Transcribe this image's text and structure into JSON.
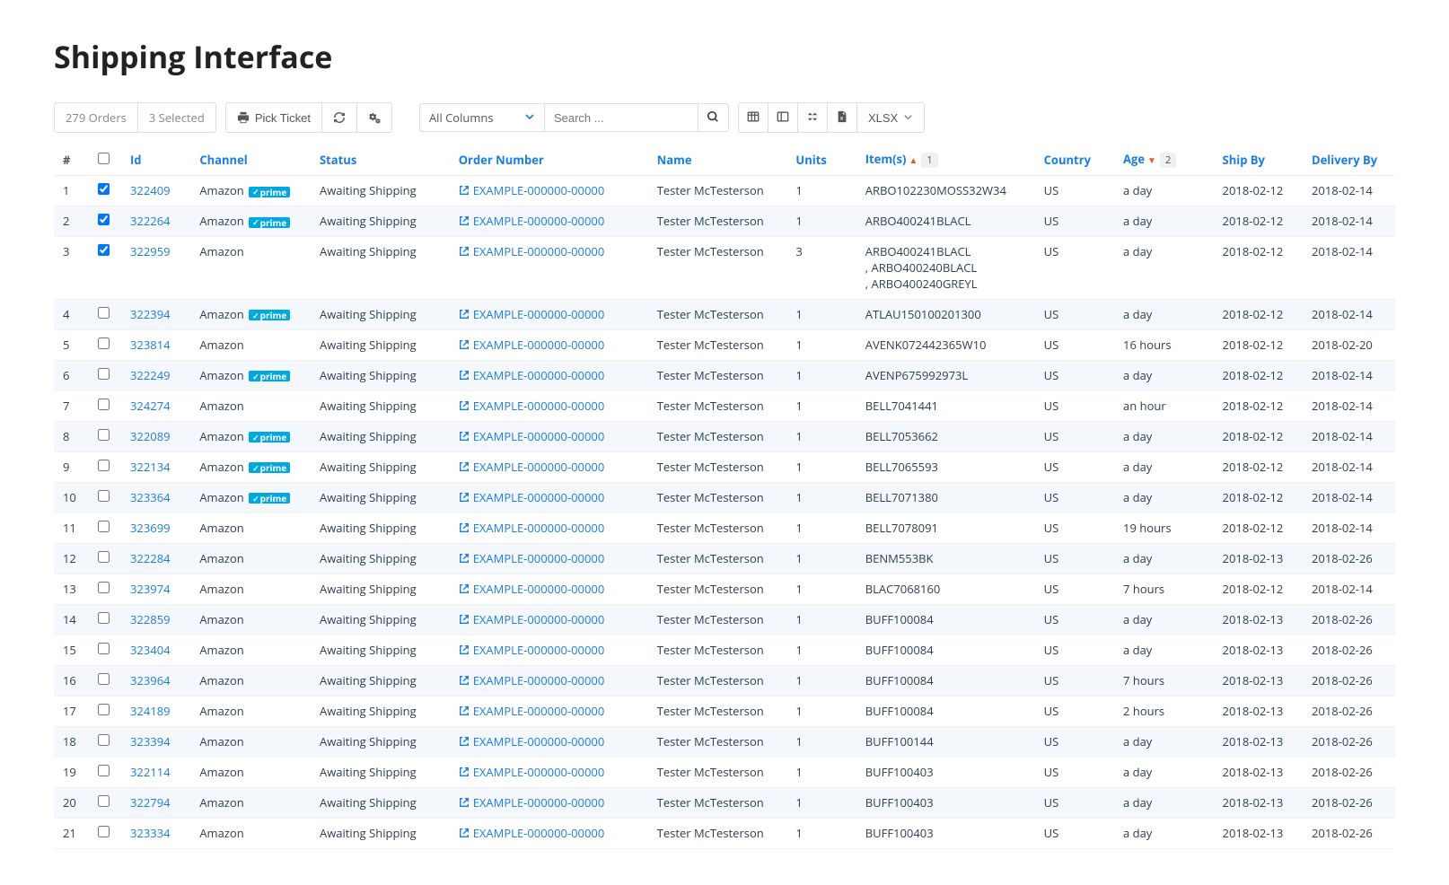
{
  "title": "Shipping Interface",
  "toolbar": {
    "order_count": "279 Orders",
    "selected_count": "3 Selected",
    "pick_ticket_label": "Pick Ticket",
    "columns_filter": "All Columns",
    "search_placeholder": "Search ...",
    "export_format": "XLSX"
  },
  "columns": {
    "row_num": "#",
    "id": "Id",
    "channel": "Channel",
    "status": "Status",
    "order_number": "Order Number",
    "name": "Name",
    "units": "Units",
    "items": "Item(s)",
    "items_badge": "1",
    "country": "Country",
    "age": "Age",
    "age_badge": "2",
    "ship_by": "Ship By",
    "delivery_by": "Delivery By"
  },
  "rows": [
    {
      "n": "1",
      "checked": true,
      "id": "322409",
      "channel": "Amazon",
      "prime": true,
      "status": "Awaiting Shipping",
      "order": "EXAMPLE-000000-00000",
      "name": "Tester McTesterson",
      "units": "1",
      "items": "ARBO102230MOSS32W34",
      "country": "US",
      "age": "a day",
      "shipby": "2018-02-12",
      "delby": "2018-02-14",
      "alt": false
    },
    {
      "n": "2",
      "checked": true,
      "id": "322264",
      "channel": "Amazon",
      "prime": true,
      "status": "Awaiting Shipping",
      "order": "EXAMPLE-000000-00000",
      "name": "Tester McTesterson",
      "units": "1",
      "items": "ARBO400241BLACL",
      "country": "US",
      "age": "a day",
      "shipby": "2018-02-12",
      "delby": "2018-02-14",
      "alt": true
    },
    {
      "n": "3",
      "checked": true,
      "id": "322959",
      "channel": "Amazon",
      "prime": false,
      "status": "Awaiting Shipping",
      "order": "EXAMPLE-000000-00000",
      "name": "Tester McTesterson",
      "units": "3",
      "items": "ARBO400241BLACL\n, ARBO400240BLACL\n, ARBO400240GREYL",
      "country": "US",
      "age": "a day",
      "shipby": "2018-02-12",
      "delby": "2018-02-14",
      "alt": false
    },
    {
      "n": "4",
      "checked": false,
      "id": "322394",
      "channel": "Amazon",
      "prime": true,
      "status": "Awaiting Shipping",
      "order": "EXAMPLE-000000-00000",
      "name": "Tester McTesterson",
      "units": "1",
      "items": "ATLAU150100201300",
      "country": "US",
      "age": "a day",
      "shipby": "2018-02-12",
      "delby": "2018-02-14",
      "alt": true
    },
    {
      "n": "5",
      "checked": false,
      "id": "323814",
      "channel": "Amazon",
      "prime": false,
      "status": "Awaiting Shipping",
      "order": "EXAMPLE-000000-00000",
      "name": "Tester McTesterson",
      "units": "1",
      "items": "AVENK072442365W10",
      "country": "US",
      "age": "16 hours",
      "shipby": "2018-02-12",
      "delby": "2018-02-20",
      "alt": false
    },
    {
      "n": "6",
      "checked": false,
      "id": "322249",
      "channel": "Amazon",
      "prime": true,
      "status": "Awaiting Shipping",
      "order": "EXAMPLE-000000-00000",
      "name": "Tester McTesterson",
      "units": "1",
      "items": "AVENP675992973L",
      "country": "US",
      "age": "a day",
      "shipby": "2018-02-12",
      "delby": "2018-02-14",
      "alt": true
    },
    {
      "n": "7",
      "checked": false,
      "id": "324274",
      "channel": "Amazon",
      "prime": false,
      "status": "Awaiting Shipping",
      "order": "EXAMPLE-000000-00000",
      "name": "Tester McTesterson",
      "units": "1",
      "items": "BELL7041441",
      "country": "US",
      "age": "an hour",
      "shipby": "2018-02-12",
      "delby": "2018-02-14",
      "alt": false
    },
    {
      "n": "8",
      "checked": false,
      "id": "322089",
      "channel": "Amazon",
      "prime": true,
      "status": "Awaiting Shipping",
      "order": "EXAMPLE-000000-00000",
      "name": "Tester McTesterson",
      "units": "1",
      "items": "BELL7053662",
      "country": "US",
      "age": "a day",
      "shipby": "2018-02-12",
      "delby": "2018-02-14",
      "alt": true
    },
    {
      "n": "9",
      "checked": false,
      "id": "322134",
      "channel": "Amazon",
      "prime": true,
      "status": "Awaiting Shipping",
      "order": "EXAMPLE-000000-00000",
      "name": "Tester McTesterson",
      "units": "1",
      "items": "BELL7065593",
      "country": "US",
      "age": "a day",
      "shipby": "2018-02-12",
      "delby": "2018-02-14",
      "alt": false
    },
    {
      "n": "10",
      "checked": false,
      "id": "323364",
      "channel": "Amazon",
      "prime": true,
      "status": "Awaiting Shipping",
      "order": "EXAMPLE-000000-00000",
      "name": "Tester McTesterson",
      "units": "1",
      "items": "BELL7071380",
      "country": "US",
      "age": "a day",
      "shipby": "2018-02-12",
      "delby": "2018-02-14",
      "alt": true
    },
    {
      "n": "11",
      "checked": false,
      "id": "323699",
      "channel": "Amazon",
      "prime": false,
      "status": "Awaiting Shipping",
      "order": "EXAMPLE-000000-00000",
      "name": "Tester McTesterson",
      "units": "1",
      "items": "BELL7078091",
      "country": "US",
      "age": "19 hours",
      "shipby": "2018-02-12",
      "delby": "2018-02-14",
      "alt": false
    },
    {
      "n": "12",
      "checked": false,
      "id": "322284",
      "channel": "Amazon",
      "prime": false,
      "status": "Awaiting Shipping",
      "order": "EXAMPLE-000000-00000",
      "name": "Tester McTesterson",
      "units": "1",
      "items": "BENM553BK",
      "country": "US",
      "age": "a day",
      "shipby": "2018-02-13",
      "delby": "2018-02-26",
      "alt": true
    },
    {
      "n": "13",
      "checked": false,
      "id": "323974",
      "channel": "Amazon",
      "prime": false,
      "status": "Awaiting Shipping",
      "order": "EXAMPLE-000000-00000",
      "name": "Tester McTesterson",
      "units": "1",
      "items": "BLAC7068160",
      "country": "US",
      "age": "7 hours",
      "shipby": "2018-02-12",
      "delby": "2018-02-14",
      "alt": false
    },
    {
      "n": "14",
      "checked": false,
      "id": "322859",
      "channel": "Amazon",
      "prime": false,
      "status": "Awaiting Shipping",
      "order": "EXAMPLE-000000-00000",
      "name": "Tester McTesterson",
      "units": "1",
      "items": "BUFF100084",
      "country": "US",
      "age": "a day",
      "shipby": "2018-02-13",
      "delby": "2018-02-26",
      "alt": true
    },
    {
      "n": "15",
      "checked": false,
      "id": "323404",
      "channel": "Amazon",
      "prime": false,
      "status": "Awaiting Shipping",
      "order": "EXAMPLE-000000-00000",
      "name": "Tester McTesterson",
      "units": "1",
      "items": "BUFF100084",
      "country": "US",
      "age": "a day",
      "shipby": "2018-02-13",
      "delby": "2018-02-26",
      "alt": false
    },
    {
      "n": "16",
      "checked": false,
      "id": "323964",
      "channel": "Amazon",
      "prime": false,
      "status": "Awaiting Shipping",
      "order": "EXAMPLE-000000-00000",
      "name": "Tester McTesterson",
      "units": "1",
      "items": "BUFF100084",
      "country": "US",
      "age": "7 hours",
      "shipby": "2018-02-13",
      "delby": "2018-02-26",
      "alt": true
    },
    {
      "n": "17",
      "checked": false,
      "id": "324189",
      "channel": "Amazon",
      "prime": false,
      "status": "Awaiting Shipping",
      "order": "EXAMPLE-000000-00000",
      "name": "Tester McTesterson",
      "units": "1",
      "items": "BUFF100084",
      "country": "US",
      "age": "2 hours",
      "shipby": "2018-02-13",
      "delby": "2018-02-26",
      "alt": false
    },
    {
      "n": "18",
      "checked": false,
      "id": "323394",
      "channel": "Amazon",
      "prime": false,
      "status": "Awaiting Shipping",
      "order": "EXAMPLE-000000-00000",
      "name": "Tester McTesterson",
      "units": "1",
      "items": "BUFF100144",
      "country": "US",
      "age": "a day",
      "shipby": "2018-02-13",
      "delby": "2018-02-26",
      "alt": true
    },
    {
      "n": "19",
      "checked": false,
      "id": "322114",
      "channel": "Amazon",
      "prime": false,
      "status": "Awaiting Shipping",
      "order": "EXAMPLE-000000-00000",
      "name": "Tester McTesterson",
      "units": "1",
      "items": "BUFF100403",
      "country": "US",
      "age": "a day",
      "shipby": "2018-02-13",
      "delby": "2018-02-26",
      "alt": false
    },
    {
      "n": "20",
      "checked": false,
      "id": "322794",
      "channel": "Amazon",
      "prime": false,
      "status": "Awaiting Shipping",
      "order": "EXAMPLE-000000-00000",
      "name": "Tester McTesterson",
      "units": "1",
      "items": "BUFF100403",
      "country": "US",
      "age": "a day",
      "shipby": "2018-02-13",
      "delby": "2018-02-26",
      "alt": true
    },
    {
      "n": "21",
      "checked": false,
      "id": "323334",
      "channel": "Amazon",
      "prime": false,
      "status": "Awaiting Shipping",
      "order": "EXAMPLE-000000-00000",
      "name": "Tester McTesterson",
      "units": "1",
      "items": "BUFF100403",
      "country": "US",
      "age": "a day",
      "shipby": "2018-02-13",
      "delby": "2018-02-26",
      "alt": false
    }
  ]
}
